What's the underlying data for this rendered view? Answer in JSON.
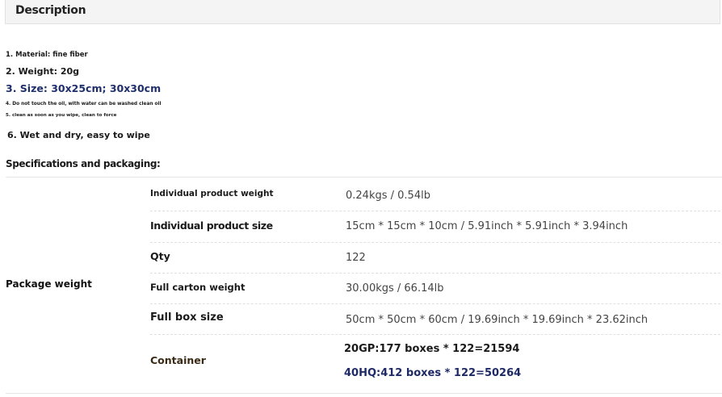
{
  "description": {
    "title": "Description",
    "items": [
      "1. Material: fine fiber",
      "2. Weight: 20g",
      "3. Size: 30x25cm; 30x30cm",
      "4. Do not touch the oil, with water can be washed clean oil",
      "5. clean as soon as you wipe, clean to force",
      "6. Wet and dry, easy to wipe"
    ]
  },
  "specs": {
    "title": "Specifications and packaging:",
    "group_label": "Package weight",
    "rows": [
      {
        "label": "Individual product weight",
        "value": "0.24kgs / 0.54lb"
      },
      {
        "label": "Individual product size",
        "value": "15cm * 15cm * 10cm / 5.91inch * 5.91inch * 3.94inch"
      },
      {
        "label": "Qty",
        "value": "122"
      },
      {
        "label": "Full carton weight",
        "value": "30.00kgs / 66.14lb"
      },
      {
        "label": "Full box size",
        "value": "50cm * 50cm * 60cm / 19.69inch * 19.69inch * 23.62inch"
      },
      {
        "label": "Container",
        "values": [
          "20GP:177 boxes * 122=21594",
          "40HQ:412 boxes * 122=50264"
        ]
      }
    ]
  },
  "colors": {
    "header_bg": "#f4f4f4",
    "accent_blue": "#1f2f6b",
    "container_label": "#3a2a14",
    "container_line2": "#1e2a66"
  }
}
